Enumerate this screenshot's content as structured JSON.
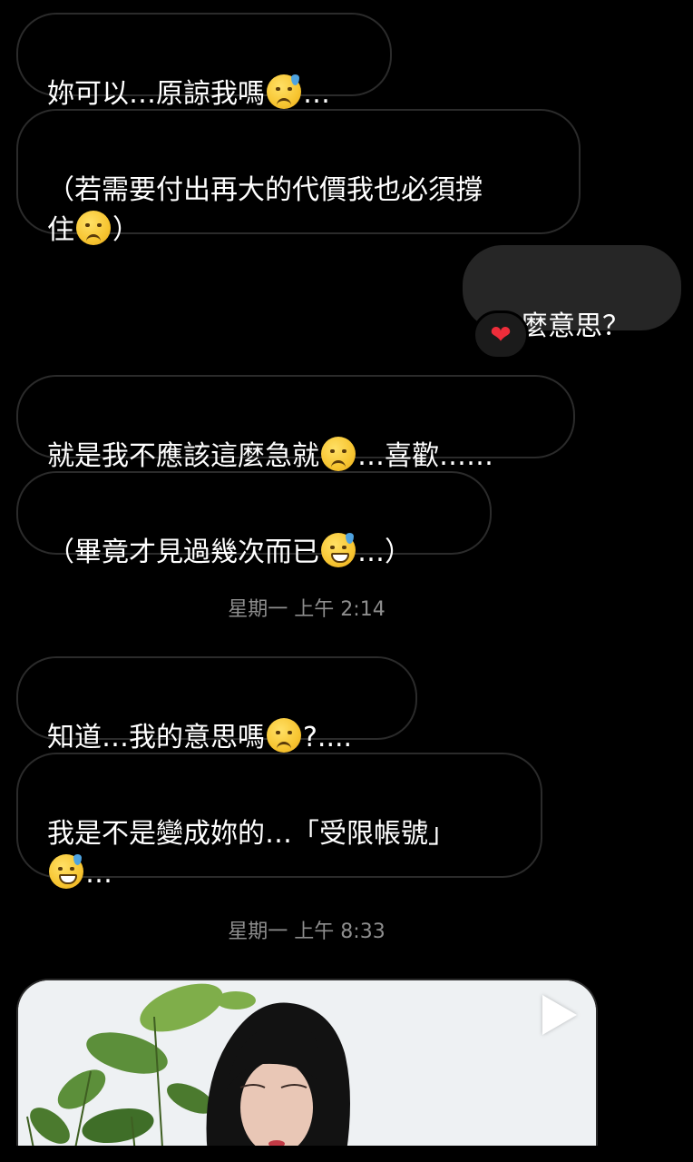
{
  "messages": [
    {
      "text1": "妳可以…原諒我嗎",
      "emoji": "downcast-sweat-emoji",
      "text2": "…"
    },
    {
      "text1": "（若需要付出再大的代價我也必須撐\n住",
      "emoji": "worried-face-emoji",
      "text2": "）"
    },
    {
      "text1": "什麼意思？"
    },
    {
      "text1": "就是我不應該這麼急就",
      "emoji": "pensive-face-emoji",
      "text2": "…喜歡……"
    },
    {
      "text1": "（畢竟才見過幾次而已",
      "emoji": "grinning-sweat-emoji",
      "text2": "…）"
    },
    {
      "text1": "知道…我的意思嗎",
      "emoji": "pensive-face-emoji",
      "text2": "?...."
    },
    {
      "text1": "我是不是變成妳的…「受限帳號」\n",
      "emoji": "grinning-sweat-emoji",
      "text2": "…"
    }
  ],
  "reaction": {
    "icon": "heart-icon",
    "glyph": "❤"
  },
  "timestamps": [
    "星期一 上午 2:14",
    "星期一 上午 8:33"
  ],
  "media": {
    "type": "video",
    "icon": "play-icon"
  },
  "colors": {
    "background": "#000000",
    "outgoing_bubble": "#262626",
    "incoming_border": "#2b2b2b",
    "timestamp": "#8e8e8e",
    "heart": "#ee2d3a"
  }
}
